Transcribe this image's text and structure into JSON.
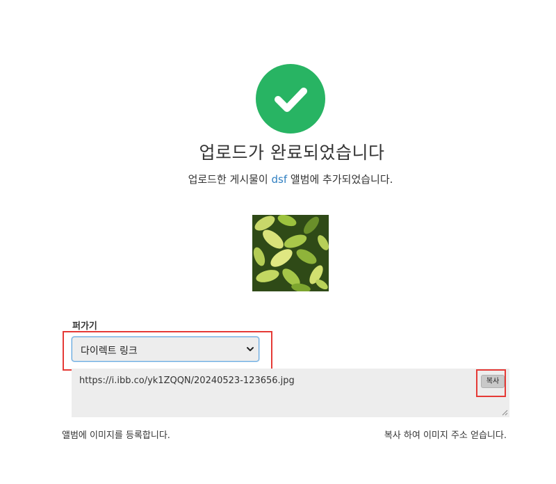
{
  "success": {
    "icon": "checkmark-icon",
    "color": "#28b463",
    "title": "업로드가 완료되었습니다",
    "subtitle_prefix": "업로드한 게시물이 ",
    "album_name": "dsf",
    "subtitle_suffix": " 앨범에 추가되었습니다."
  },
  "embed": {
    "label": "퍼가기",
    "selected_option": "다이렉트 링크",
    "url": "https://i.ibb.co/yk1ZQQN/20240523-123656.jpg",
    "copy_label": "복사"
  },
  "notes": {
    "left": "앨범에 이미지를 등록합니다.",
    "right": "복사 하여 이미지 주소 얻습니다."
  },
  "colors": {
    "accent": "#2f7fc1",
    "highlight": "#e53935"
  }
}
